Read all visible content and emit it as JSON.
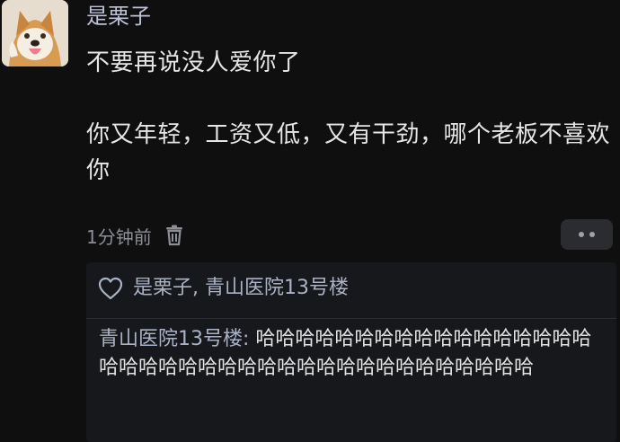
{
  "post": {
    "username": "是栗子",
    "avatar_icon": "shiba-dog-avatar",
    "message_line1": "不要再说没人爱你了",
    "message_line2": "你又年轻，工资又低，又有干劲，哪个老板不喜欢你",
    "time": "1分钟前",
    "delete_icon": "trash-icon",
    "more_icon": "more-dots-icon"
  },
  "interactions": {
    "heart_icon": "heart-outline-icon",
    "likers": "是栗子, 青山医院13号楼",
    "reply_author": "青山医院13号楼",
    "reply_separator": ": ",
    "reply_text": "哈哈哈哈哈哈哈哈哈哈哈哈哈哈哈哈哈哈哈哈哈哈哈哈哈哈哈哈哈哈哈哈哈哈哈哈哈哈哈"
  },
  "colors": {
    "background": "#0f0f10",
    "username": "#bcc3d6",
    "text": "#e6e6e6",
    "meta": "#8d8f96",
    "reply_panel": "#17181b"
  }
}
